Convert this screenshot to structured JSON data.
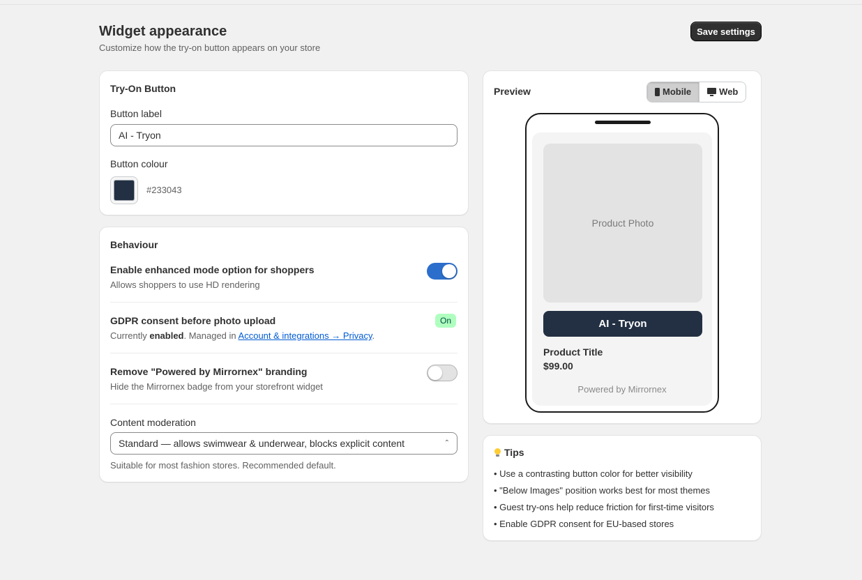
{
  "header": {
    "title": "Widget appearance",
    "subtitle": "Customize how the try-on button appears on your store",
    "save_label": "Save settings"
  },
  "try_on_button": {
    "title": "Try-On Button",
    "label_field_label": "Button label",
    "label_value": "AI - Tryon",
    "colour_label": "Button colour",
    "colour_hex": "#233043"
  },
  "behaviour": {
    "title": "Behaviour",
    "enhanced": {
      "title": "Enable enhanced mode option for shoppers",
      "description": "Allows shoppers to use HD rendering",
      "enabled": true
    },
    "gdpr": {
      "title": "GDPR consent before photo upload",
      "desc_prefix": "Currently ",
      "desc_state": "enabled",
      "desc_middle": ". Managed in ",
      "desc_link": "Account & integrations → Privacy",
      "desc_suffix": ".",
      "badge": "On"
    },
    "branding": {
      "title": "Remove \"Powered by Mirrornex\" branding",
      "description": "Hide the Mirrornex badge from your storefront widget",
      "enabled": false
    },
    "moderation": {
      "label": "Content moderation",
      "selected": "Standard — allows swimwear & underwear, blocks explicit content",
      "help": "Suitable for most fashion stores. Recommended default."
    }
  },
  "preview": {
    "title": "Preview",
    "tabs": [
      {
        "label": "Mobile",
        "icon": "mobile-icon",
        "active": true
      },
      {
        "label": "Web",
        "icon": "monitor-icon",
        "active": false
      }
    ],
    "product_photo": "Product Photo",
    "button_label": "AI - Tryon",
    "product_title": "Product Title",
    "price": "$99.00",
    "powered_by": "Powered by Mirrornex"
  },
  "tips": {
    "title": "Tips",
    "icon": "lightbulb-icon",
    "items": [
      "• Use a contrasting button color for better visibility",
      "• \"Below Images\" position works best for most themes",
      "• Guest try-ons help reduce friction for first-time visitors",
      "• Enable GDPR consent for EU-based stores"
    ]
  },
  "colors": {
    "button_colour": "#233043",
    "toggle_on": "#2c6ecb",
    "badge_on_bg": "#affebf",
    "link": "#005bd3"
  }
}
